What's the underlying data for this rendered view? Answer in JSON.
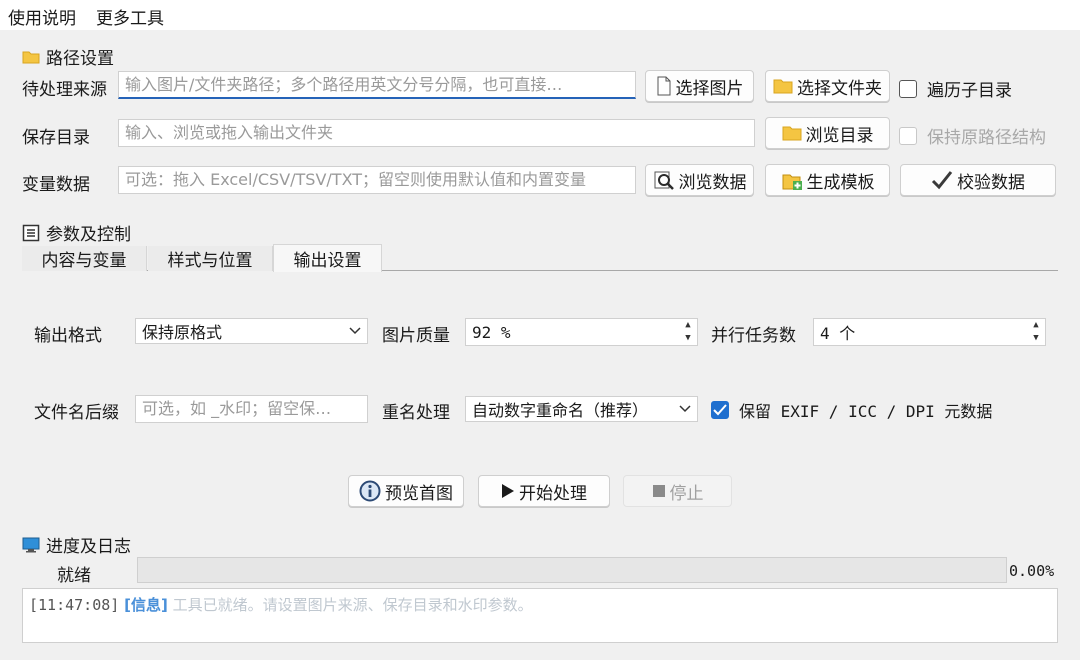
{
  "menubar": {
    "usage": "使用说明",
    "more_tools": "更多工具"
  },
  "path_section": {
    "title": "路径设置",
    "source_label": "待处理来源",
    "source_placeholder": "输入图片/文件夹路径；多个路径用英文分号分隔，也可直接…",
    "select_image_btn": "选择图片",
    "select_folder_btn": "选择文件夹",
    "traverse_subdir": "遍历子目录",
    "save_label": "保存目录",
    "save_placeholder": "输入、浏览或拖入输出文件夹",
    "browse_dir_btn": "浏览目录",
    "keep_structure": "保持原路径结构",
    "var_label": "变量数据",
    "var_placeholder": "可选：拖入 Excel/CSV/TSV/TXT；留空则使用默认值和内置变量",
    "browse_data_btn": "浏览数据",
    "gen_template_btn": "生成模板",
    "validate_btn": "校验数据"
  },
  "params_section": {
    "title": "参数及控制",
    "tabs": [
      "内容与变量",
      "样式与位置",
      "输出设置"
    ],
    "active_tab": 2
  },
  "output": {
    "format_label": "输出格式",
    "format_value": "保持原格式",
    "quality_label": "图片质量",
    "quality_value": "92 %",
    "parallel_label": "并行任务数",
    "parallel_value": "4 个",
    "suffix_label": "文件名后缀",
    "suffix_placeholder": "可选，如 _水印；留空保…",
    "rename_label": "重名处理",
    "rename_value": "自动数字重命名（推荐）",
    "keep_meta": "保留 EXIF / ICC / DPI 元数据",
    "keep_meta_checked": true
  },
  "actions": {
    "preview": "预览首图",
    "start": "开始处理",
    "stop": "停止"
  },
  "progress_section": {
    "title": "进度及日志",
    "status": "就绪",
    "percent": "0.00%",
    "progress_value": 0,
    "log_time": "[11:47:08]",
    "log_level": "[信息]",
    "log_message": "工具已就绪。请设置图片来源、保存目录和水印参数。"
  },
  "colors": {
    "accent": "#1f6fcf",
    "log_level": "#4a90d9",
    "log_text": "#c0c8d0",
    "folder": "#f4c542"
  }
}
